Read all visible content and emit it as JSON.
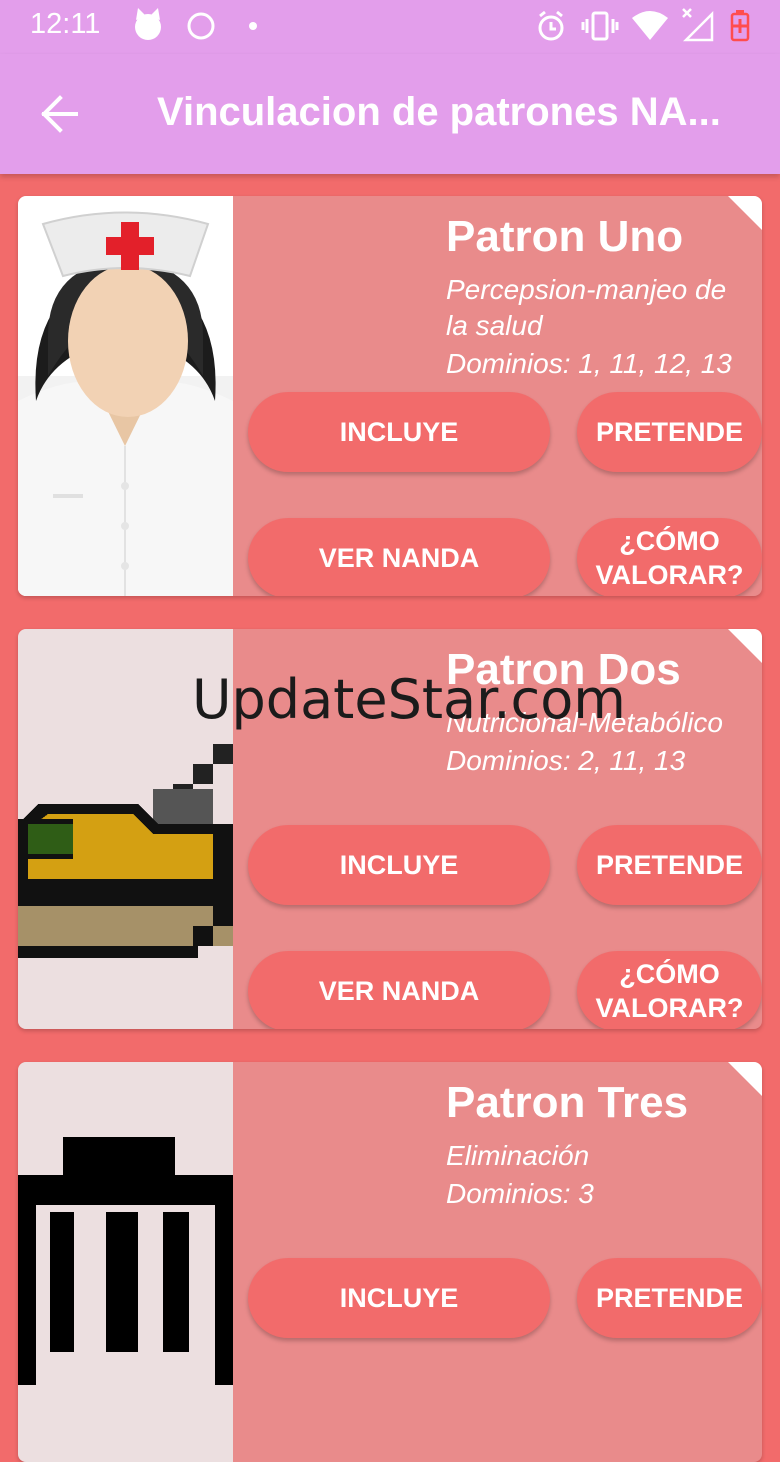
{
  "status_bar": {
    "time": "12:11",
    "icons": [
      "cat-face-icon",
      "circle-icon",
      "dot-icon",
      "alarm-icon",
      "vibrate-icon",
      "wifi-icon",
      "no-signal-icon",
      "battery-charging-icon"
    ]
  },
  "app_bar": {
    "title": "Vinculacion de patrones NA...",
    "back_icon": "arrow-left-icon",
    "color": "#e39eeb"
  },
  "theme": {
    "background": "#f26b6b",
    "card_color": "#e98b8b",
    "button_color": "#f26b6b"
  },
  "cards": [
    {
      "title": "Patron Uno",
      "subtitle": "Percepsion-manjeo de la salud",
      "domains": "Dominios: 1, 11, 12, 13",
      "image_icon": "nurse-icon",
      "buttons": {
        "includes": "INCLUYE",
        "intends": "PRETENDE",
        "nanda": "VER NANDA",
        "assess": "¿CÓMO VALORAR?"
      }
    },
    {
      "title": "Patron Dos",
      "subtitle": "Nutricional-Metabólico",
      "domains": "Dominios: 2, 11, 13",
      "image_icon": "food-bowl-icon",
      "buttons": {
        "includes": "INCLUYE",
        "intends": "PRETENDE",
        "nanda": "VER NANDA",
        "assess": "¿CÓMO VALORAR?"
      }
    },
    {
      "title": "Patron Tres",
      "subtitle": "Eliminación",
      "domains": "Dominios: 3",
      "image_icon": "trash-can-icon",
      "buttons": {
        "includes": "INCLUYE",
        "intends": "PRETENDE"
      }
    }
  ],
  "watermark": "UpdateStar.com"
}
